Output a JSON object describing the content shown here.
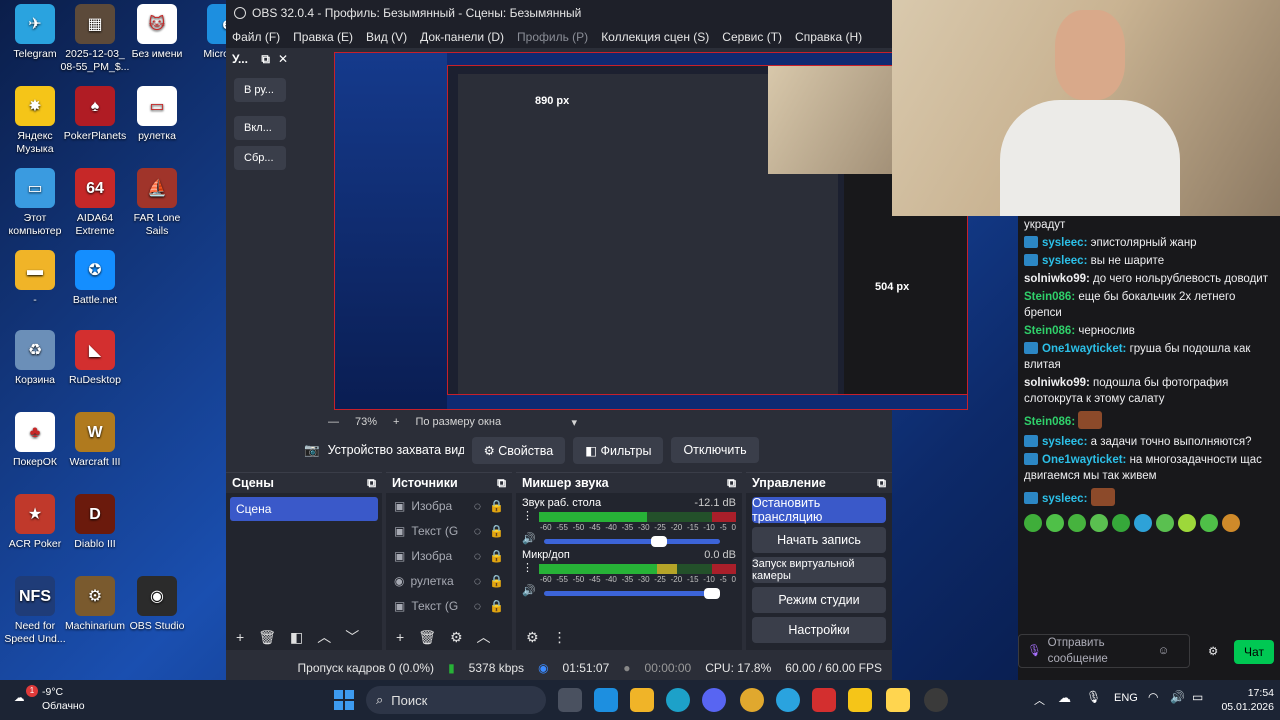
{
  "desktop": {
    "icons": [
      {
        "label": "Telegram",
        "name": "telegram-icon",
        "color": "#2aa3df",
        "glyph": "✈"
      },
      {
        "label": "2025-12-03_ 08-55_PM_$...",
        "name": "screenshot-file-icon",
        "color": "#5c4a3a",
        "glyph": "▦"
      },
      {
        "label": "Без имени",
        "name": "image-file-icon",
        "color": "#ffffff",
        "glyph": "🐱"
      },
      {
        "label": "Micro Edg",
        "name": "edge-icon",
        "color": "#1d8fe0",
        "glyph": "e"
      },
      {
        "label": "Яндекс Музыка",
        "name": "yandex-music-icon",
        "color": "#f5c518",
        "glyph": "✸"
      },
      {
        "label": "PokerPlanets",
        "name": "pokerplanets-icon",
        "color": "#b01c24",
        "glyph": "♠"
      },
      {
        "label": "рулетка",
        "name": "roulette-file-icon",
        "color": "#ffffff",
        "glyph": "▭"
      },
      {
        "label": "Этот компьютер",
        "name": "this-pc-icon",
        "color": "#3a9be0",
        "glyph": "▭"
      },
      {
        "label": "AIDA64 Extreme",
        "name": "aida64-icon",
        "color": "#c62828",
        "glyph": "64"
      },
      {
        "label": "FAR Lone Sails",
        "name": "far-lone-sails-icon",
        "color": "#a0342a",
        "glyph": "⛵"
      },
      {
        "label": "-",
        "name": "folder-icon",
        "color": "#f0b428",
        "glyph": "▬"
      },
      {
        "label": "Battle.net",
        "name": "battlenet-icon",
        "color": "#148eff",
        "glyph": "✪"
      },
      {
        "label": "Корзина",
        "name": "recycle-bin-icon",
        "color": "#6b8fb8",
        "glyph": "♻"
      },
      {
        "label": "RuDesktop",
        "name": "rudesktop-icon",
        "color": "#d32f2f",
        "glyph": "◣"
      },
      {
        "label": "ПокерОК",
        "name": "pokerok-icon",
        "color": "#ffffff",
        "glyph": "♣"
      },
      {
        "label": "Warcraft III",
        "name": "warcraft-icon",
        "color": "#b07a1e",
        "glyph": "W"
      },
      {
        "label": "ACR Poker",
        "name": "acr-poker-icon",
        "color": "#c0392b",
        "glyph": "★"
      },
      {
        "label": "Diablo III",
        "name": "diablo-icon",
        "color": "#6b1a0c",
        "glyph": "D"
      },
      {
        "label": "Need for Speed Und...",
        "name": "need-for-speed-icon",
        "color": "#1f3c78",
        "glyph": "NFS"
      },
      {
        "label": "Machinarium",
        "name": "machinarium-icon",
        "color": "#7a5a2e",
        "glyph": "⚙"
      },
      {
        "label": "OBS Studio",
        "name": "obs-desktop-icon",
        "color": "#2b2b2b",
        "glyph": "◉"
      }
    ]
  },
  "obs": {
    "title": "OBS 32.0.4 - Профиль: Безымянный - Сцены: Безымянный",
    "menu": [
      {
        "label": "Файл (F)",
        "disabled": false
      },
      {
        "label": "Правка (E)",
        "disabled": false
      },
      {
        "label": "Вид (V)",
        "disabled": false
      },
      {
        "label": "Док-панели (D)",
        "disabled": false
      },
      {
        "label": "Профиль (P)",
        "disabled": true
      },
      {
        "label": "Коллекция сцен (S)",
        "disabled": false
      },
      {
        "label": "Сервис (T)",
        "disabled": false
      },
      {
        "label": "Справка (H)",
        "disabled": false
      }
    ],
    "side_panel": {
      "title": "У...",
      "buttons": [
        "В ру...",
        "Вкл...",
        "Сбр..."
      ]
    },
    "preview_overlay": {
      "width_label": "890 px",
      "height_label": "504 px"
    },
    "zoom": {
      "value": "73%",
      "mode": "По размеру окна"
    },
    "source_toolbar": {
      "source_name": "Устройство захвата видео",
      "properties": "Свойства",
      "filters": "Фильтры",
      "disconnect": "Отключить"
    },
    "scenes": {
      "title": "Сцены",
      "items": [
        "Сцена"
      ]
    },
    "sources": {
      "title": "Источники",
      "items": [
        "Изобра",
        "Текст (G",
        "Изобра",
        "рулетка",
        "Текст (G"
      ]
    },
    "mixer": {
      "title": "Микшер звука",
      "tracks": [
        {
          "name": "Звук раб. стола",
          "db": "-12.1 dB",
          "level": 0.55
        },
        {
          "name": "Микр/доп",
          "db": "0.0 dB",
          "level": 0.7
        }
      ],
      "scale": [
        "-60",
        "-55",
        "-50",
        "-45",
        "-40",
        "-35",
        "-30",
        "-25",
        "-20",
        "-15",
        "-10",
        "-5",
        "0"
      ]
    },
    "controls": {
      "title": "Управление",
      "buttons": [
        "Остановить трансляцию",
        "Начать запись",
        "Запуск виртуальной камеры",
        "Режим студии",
        "Настройки"
      ]
    },
    "status": {
      "dropped": "Пропуск кадров 0 (0.0%)",
      "bitrate": "5378 kbps",
      "stream_time": "01:51:07",
      "rec_time": "00:00:00",
      "cpu": "CPU: 17.8%",
      "fps": "60.00 / 60.00 FPS"
    }
  },
  "chat": {
    "messages": [
      {
        "user": "",
        "text": "украдут",
        "badge": false,
        "color": "#efeff1"
      },
      {
        "user": "sysleec",
        "text": "эпистолярный жанр",
        "badge": true,
        "color": "#2cc0e8"
      },
      {
        "user": "sysleec",
        "text": "вы не шарите",
        "badge": true,
        "color": "#2cc0e8"
      },
      {
        "user": "solniwko99",
        "text": "до чего нольрублевость доводит",
        "badge": false,
        "color": "#efeff1"
      },
      {
        "user": "Stein086",
        "text": "еще бы бокальчик 2х летнего брепси",
        "badge": false,
        "color": "#2fd06a"
      },
      {
        "user": "Stein086",
        "text": "чернослив",
        "badge": false,
        "color": "#2fd06a"
      },
      {
        "user": "One1wayticket",
        "text": "груша бы подошла как влитая",
        "badge": true,
        "color": "#2cc0e8"
      },
      {
        "user": "solniwko99",
        "text": "подошла бы фотография слотокрута к этому салату",
        "badge": false,
        "color": "#efeff1"
      },
      {
        "user": "Stein086",
        "text": "",
        "badge": false,
        "color": "#2fd06a",
        "emote": true
      },
      {
        "user": "sysleec",
        "text": "а задачи точно выполняются?",
        "badge": true,
        "color": "#2cc0e8"
      },
      {
        "user": "One1wayticket",
        "text": "на многозадачности щас двигаемся мы так живем",
        "badge": true,
        "color": "#2cc0e8"
      },
      {
        "user": "sysleec",
        "text": "",
        "badge": true,
        "color": "#2cc0e8",
        "emote": true
      }
    ],
    "input_placeholder": "Отправить сообщение",
    "send_label": "Чат"
  },
  "taskbar": {
    "weather_temp": "-9°C",
    "weather_text": "Облачно",
    "weather_badge": "1",
    "search_label": "Поиск",
    "lang": "ENG",
    "time": "17:54",
    "date": "05.01.2026"
  }
}
